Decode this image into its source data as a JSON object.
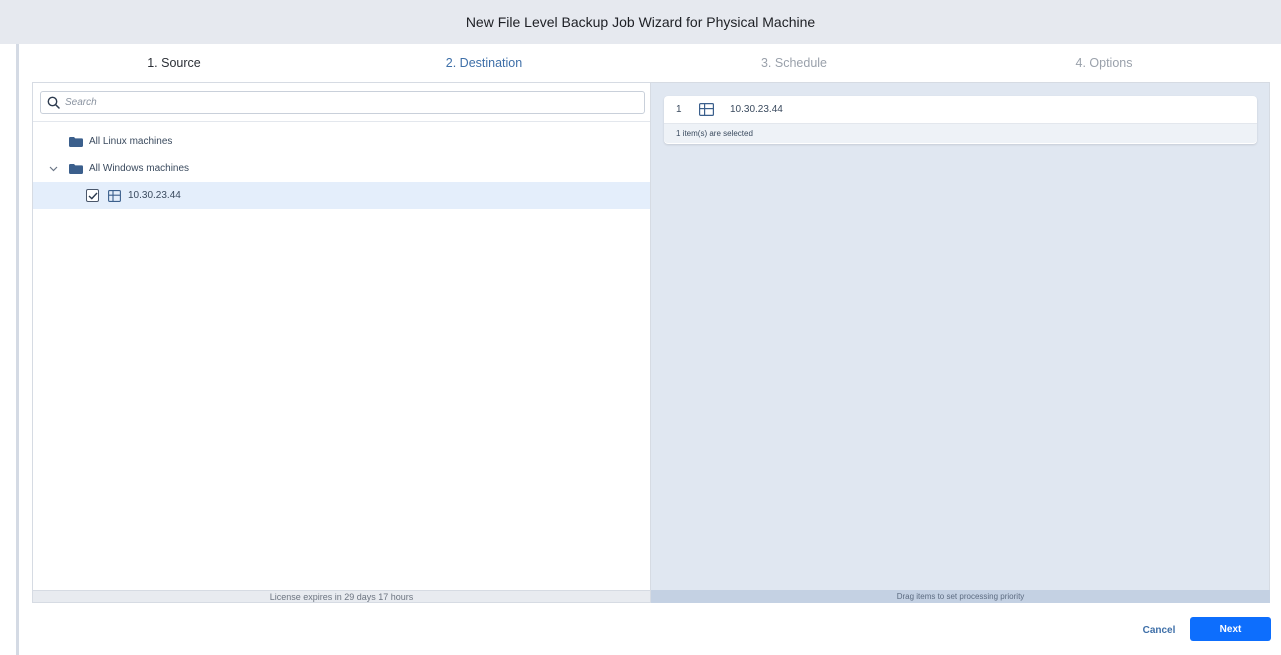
{
  "window": {
    "title": "New File Level Backup Job Wizard for Physical Machine"
  },
  "steps": [
    {
      "label": "1. Source",
      "state": "done"
    },
    {
      "label": "2. Destination",
      "state": "active"
    },
    {
      "label": "3. Schedule",
      "state": "pending"
    },
    {
      "label": "4. Options",
      "state": "pending"
    }
  ],
  "search": {
    "placeholder": "Search",
    "value": "",
    "icon": "search-icon"
  },
  "tree": {
    "items": [
      {
        "label": "All Linux machines",
        "icon": "folder-icon",
        "expanded": false
      },
      {
        "label": "All Windows machines",
        "icon": "folder-icon",
        "expanded": true
      },
      {
        "label": "10.30.23.44",
        "icon": "windows-icon",
        "checked": true,
        "selected": true
      }
    ]
  },
  "left_footer": {
    "text": "License expires in 29 days 17 hours"
  },
  "selection": {
    "items": [
      {
        "number": "1",
        "icon": "windows-icon",
        "label": "10.30.23.44"
      }
    ],
    "count_text": "1 item(s) are selected"
  },
  "right_footer": {
    "text": "Drag items to set processing priority"
  },
  "buttons": {
    "cancel": "Cancel",
    "next": "Next"
  },
  "colors": {
    "accent": "#0d6efd",
    "active_step": "#3e6fa8",
    "selected_row": "#e4eefb",
    "right_pane_bg": "#e0e7f1"
  }
}
